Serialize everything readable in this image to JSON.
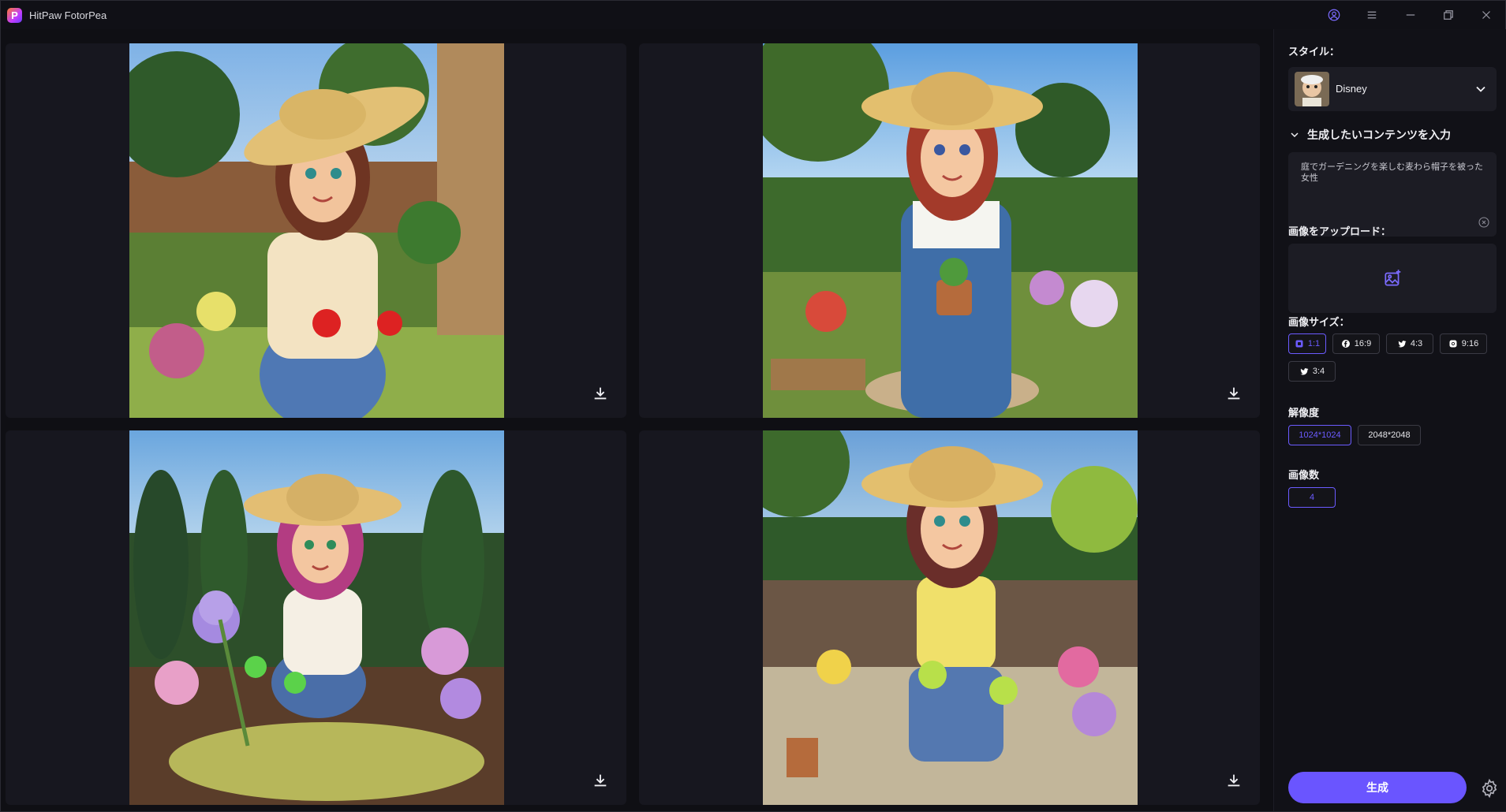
{
  "app": {
    "logo_letter": "P",
    "title": "HitPaw FotorPea"
  },
  "titlebar": {
    "icons": [
      "user-account-icon",
      "menu-icon",
      "minimize-icon",
      "restore-icon",
      "close-icon"
    ]
  },
  "gallery": {
    "images": [
      {
        "name": "generated-image-1",
        "download_icon": "download-icon"
      },
      {
        "name": "generated-image-2",
        "download_icon": "download-icon"
      },
      {
        "name": "generated-image-3",
        "download_icon": "download-icon"
      },
      {
        "name": "generated-image-4",
        "download_icon": "download-icon"
      }
    ]
  },
  "sidebar": {
    "style_label": "スタイル：",
    "style_value": "Disney",
    "content_section": "生成したいコンテンツを入力",
    "prompt_text": "庭でガーデニングを楽しむ麦わら帽子を被った女性",
    "upload_label": "画像をアップロード：",
    "size_label": "画像サイズ：",
    "sizes": [
      {
        "label": "1:1",
        "icon": "square-icon",
        "selected": true
      },
      {
        "label": "16:9",
        "icon": "facebook-icon",
        "selected": false
      },
      {
        "label": "4:3",
        "icon": "twitter-icon",
        "selected": false
      },
      {
        "label": "9:16",
        "icon": "instagram-icon",
        "selected": false
      },
      {
        "label": "3:4",
        "icon": "twitter-icon",
        "selected": false
      }
    ],
    "resolution_label": "解像度",
    "resolutions": [
      {
        "label": "1024*1024",
        "selected": true
      },
      {
        "label": "2048*2048",
        "selected": false
      }
    ],
    "count_label": "画像数",
    "count_value": "4",
    "generate_label": "生成"
  },
  "colors": {
    "accent": "#6a55ff",
    "background": "#0f0f14",
    "panel": "#1c1c24"
  }
}
